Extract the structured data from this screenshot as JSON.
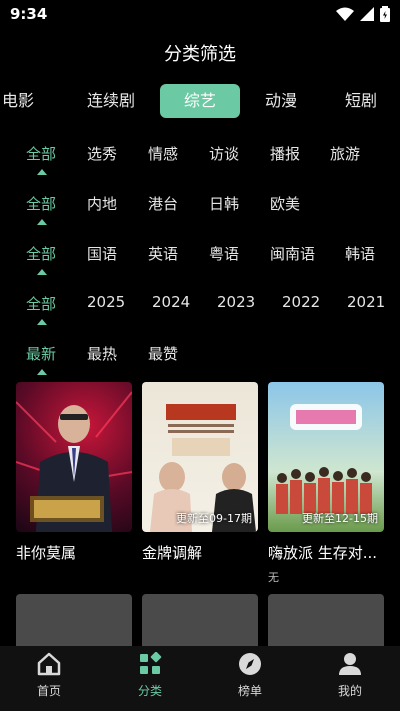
{
  "status": {
    "time": "9:34"
  },
  "page_title": "分类筛选",
  "type_tabs": [
    "电影",
    "连续剧",
    "综艺",
    "动漫",
    "短剧"
  ],
  "filters": [
    {
      "items": [
        "全部",
        "选秀",
        "情感",
        "访谈",
        "播报",
        "旅游"
      ],
      "selected": 0
    },
    {
      "items": [
        "全部",
        "内地",
        "港台",
        "日韩",
        "欧美"
      ],
      "selected": 0
    },
    {
      "items": [
        "全部",
        "国语",
        "英语",
        "粤语",
        "闽南语",
        "韩语"
      ],
      "selected": 0
    },
    {
      "items": [
        "全部",
        "2025",
        "2024",
        "2023",
        "2022",
        "2021"
      ],
      "selected": 0
    },
    {
      "items": [
        "最新",
        "最热",
        "最赞"
      ],
      "selected": 0
    }
  ],
  "cards": [
    {
      "title": "非你莫属",
      "badge": "",
      "sub": ""
    },
    {
      "title": "金牌调解",
      "badge": "更新至09-17期",
      "sub": ""
    },
    {
      "title": "嗨放派 生存对...",
      "badge": "更新至12-15期",
      "sub": "无"
    }
  ],
  "bottom_nav": [
    {
      "label": "首页",
      "active": false
    },
    {
      "label": "分类",
      "active": true
    },
    {
      "label": "榜单",
      "active": false
    },
    {
      "label": "我的",
      "active": false
    }
  ],
  "colors": {
    "accent": "#6bc9a3",
    "background": "#000000"
  }
}
